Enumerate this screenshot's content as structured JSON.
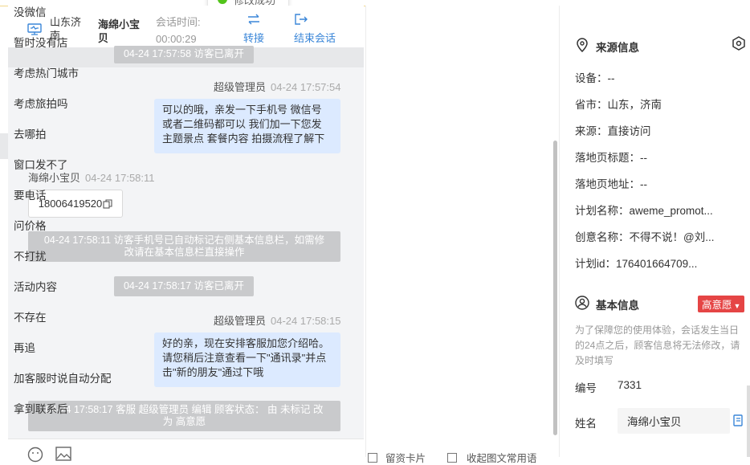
{
  "toast": {
    "text": "修改成功"
  },
  "header": {
    "location_line1": "山东济",
    "location_line2": "南",
    "visitor_line1": "海绵小宝",
    "visitor_line2": "贝",
    "session_label": "会话时间:",
    "session_time": "00:00:29",
    "transfer_label": "转接",
    "end_label": "结束会话"
  },
  "chat": {
    "messages": [
      {
        "type": "system",
        "text": "04-24 17:57:58 访客已离开"
      },
      {
        "type": "agent",
        "sender": "超级管理员",
        "time": "04-24 17:57:54",
        "lines": [
          "可以的哦，亲发一下手机号 微信号",
          "或者二维码都可以 我们加一下您发",
          "主题景点 套餐内容 拍摄流程了解下"
        ]
      },
      {
        "type": "visitor",
        "sender": "海绵小宝贝",
        "time": "04-24 17:58:11",
        "phone": "18006419520"
      },
      {
        "type": "system",
        "lines": [
          "04-24 17:58:11 访客手机号已自动标记右侧基本信息栏，如需修",
          "改请在基本信息栏直接操作"
        ]
      },
      {
        "type": "system",
        "text": "04-24 17:58:17 访客已离开"
      },
      {
        "type": "agent",
        "sender": "超级管理员",
        "time": "04-24 17:58:15",
        "lines": [
          "好的亲，现在安排客服加您介绍哈。",
          "请您稍后注意查看一下\"通讯录\"并点",
          "击\"新的朋友\"通过下哦"
        ]
      },
      {
        "type": "system",
        "lines": [
          "04-24 17:58:17 客服 超级管理员 编辑 顾客状态： 由 未标记 改",
          "为 高意愿"
        ]
      }
    ],
    "footer": {
      "tag_label": "留资卡片",
      "collapse_label": "收起图文常用语"
    }
  },
  "quick_replies": {
    "items": [
      "没微信",
      "暂时没有店",
      "考虑热门城市",
      "考虑旅拍吗",
      "去哪拍",
      "窗口发不了",
      "要电话",
      "问价格",
      "不打扰",
      "活动内容",
      "不存在",
      "再追",
      "加客服时说自动分配",
      "拿到联系后"
    ]
  },
  "source_info": {
    "title": "来源信息",
    "rows": [
      {
        "label": "设备：",
        "value": "--"
      },
      {
        "label": "省市：",
        "value": "山东，济南"
      },
      {
        "label": "来源：",
        "value": "直接访问"
      },
      {
        "label": "落地页标题：",
        "value": "--"
      },
      {
        "label": "落地页地址：",
        "value": "--"
      },
      {
        "label": "计划名称：",
        "value": "aweme_promot..."
      },
      {
        "label": "创意名称：",
        "value": "不得不说！@刘..."
      },
      {
        "label": "计划id：",
        "value": "176401664709..."
      }
    ]
  },
  "basic_info": {
    "title": "基本信息",
    "intent_badge": "高意愿",
    "note_lines": [
      "为了保障您的使用体验，会话发生当日",
      "的24点之后，顾客信息将无法修改，请",
      "及时填写"
    ],
    "id_label": "编号",
    "id_value": "7331",
    "name_label": "姓名",
    "name_value": "海绵小宝贝"
  },
  "colors": {
    "accent": "#3a86d8",
    "system_msg": "#c9cacc",
    "agent_bubble": "#dceaff",
    "badge": "#e54545"
  }
}
